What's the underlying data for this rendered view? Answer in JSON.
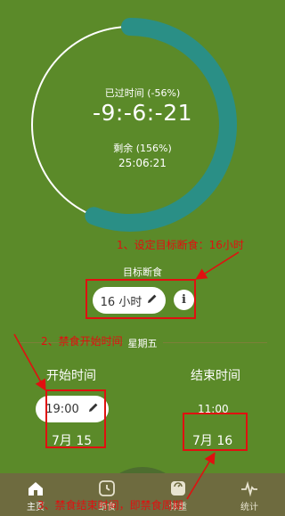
{
  "colors": {
    "background": "#5b8a29",
    "ring_track": "#ffffff",
    "ring_progress": "#2a8f86",
    "annotation": "#e01010",
    "nav_bar": "#6e6b3f"
  },
  "progress": {
    "ring_fraction": 0.56
  },
  "timer": {
    "elapsed_label": "已过时间 (-56%)",
    "elapsed_value": "-9:-6:-21",
    "remaining_label": "剩余 (156%)",
    "end_clock": "25:06:21"
  },
  "goal": {
    "label": "目标断食",
    "value": "16 小时",
    "edit_icon": "pencil-icon",
    "info_icon": "info-icon"
  },
  "schedule": {
    "weekday": "星期五",
    "start_label": "开始时间",
    "start_time": "19:00",
    "start_date": "7月 15",
    "end_label": "结束时间",
    "end_time": "11:00",
    "end_date": "7月 16"
  },
  "annotations": {
    "a1": "1、设定目标断食：16小时",
    "a2": "2、禁食开始时间",
    "a3": "3、禁食结束时间，即禁食周期"
  },
  "nav": {
    "items": [
      {
        "label": "主页",
        "icon": "home-icon"
      },
      {
        "label": "断食",
        "icon": "clock-icon"
      },
      {
        "label": "体重",
        "icon": "scale-icon"
      },
      {
        "label": "统计",
        "icon": "pulse-icon"
      }
    ]
  }
}
